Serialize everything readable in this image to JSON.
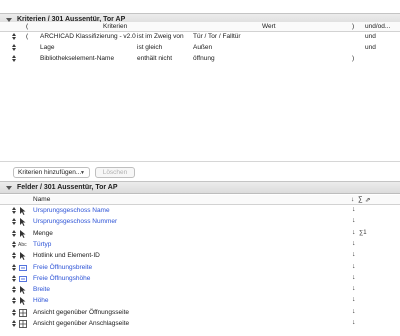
{
  "criteria_section": {
    "title": "Kriterien / 301 Aussentür, Tor AP",
    "columns": {
      "open": "(",
      "criteria": "Kriterien",
      "value": "Wert",
      "close": ")",
      "and_or": "und/od..."
    },
    "rows": [
      {
        "open": "(",
        "criterion": "ARCHICAD Klassifizierung - v2.0",
        "operator": "ist im Zweig von",
        "value": "Tür / Tor / Falltür",
        "close": "",
        "and_or": "und"
      },
      {
        "open": "",
        "criterion": "Lage",
        "operator": "ist gleich",
        "value": "Außen",
        "close": "",
        "and_or": "und"
      },
      {
        "open": "",
        "criterion": "Bibliothekselement-Name",
        "operator": "enthält nicht",
        "value": "öffnung",
        "close": ")",
        "and_or": ""
      }
    ],
    "add_criteria_label": "Kriterien hinzufügen...",
    "delete_label": "Löschen"
  },
  "fields_section": {
    "title": "Felder / 301 Aussentür, Tor AP",
    "columns": {
      "name": "Name",
      "sort": "↓",
      "sum": "∑",
      "link": "⇗"
    },
    "fields": [
      {
        "label": "Ursprungsgeschoss Name",
        "icon": "cursor-arrow-icon",
        "color": "blue",
        "sort": "↓",
        "sum": ""
      },
      {
        "label": "Ursprungsgeschoss Nummer",
        "icon": "cursor-arrow-icon",
        "color": "blue",
        "sort": "↓",
        "sum": ""
      },
      {
        "label": "Menge",
        "icon": "cursor-arrow-icon",
        "color": "black",
        "sort": "↓",
        "sum": "∑1"
      },
      {
        "label": "Türtyp",
        "icon": "abc-text-icon",
        "color": "blue",
        "sort": "↓",
        "sum": ""
      },
      {
        "label": "Hotlink und Element-ID",
        "icon": "cursor-arrow-icon",
        "color": "black",
        "sort": "↓",
        "sum": ""
      },
      {
        "label": "Freie Öffnungsbreite",
        "icon": "dimension-icon",
        "color": "blue",
        "sort": "↓",
        "sum": ""
      },
      {
        "label": "Freie Öffnungshöhe",
        "icon": "dimension-icon",
        "color": "blue",
        "sort": "↓",
        "sum": ""
      },
      {
        "label": "Breite",
        "icon": "cursor-arrow-icon",
        "color": "blue",
        "sort": "↓",
        "sum": ""
      },
      {
        "label": "Höhe",
        "icon": "cursor-arrow-icon",
        "color": "blue",
        "sort": "↓",
        "sum": ""
      },
      {
        "label": "Ansicht gegenüber Öffnungsseite",
        "icon": "grid-view-icon",
        "color": "black",
        "sort": "↓",
        "sum": ""
      },
      {
        "label": "Ansicht gegenüber Anschlagseite",
        "icon": "grid-view-icon",
        "color": "black",
        "sort": "↓",
        "sum": ""
      }
    ]
  },
  "colors": {
    "link_blue": "#2b52d6",
    "header_bg": "#e2e2e2"
  }
}
